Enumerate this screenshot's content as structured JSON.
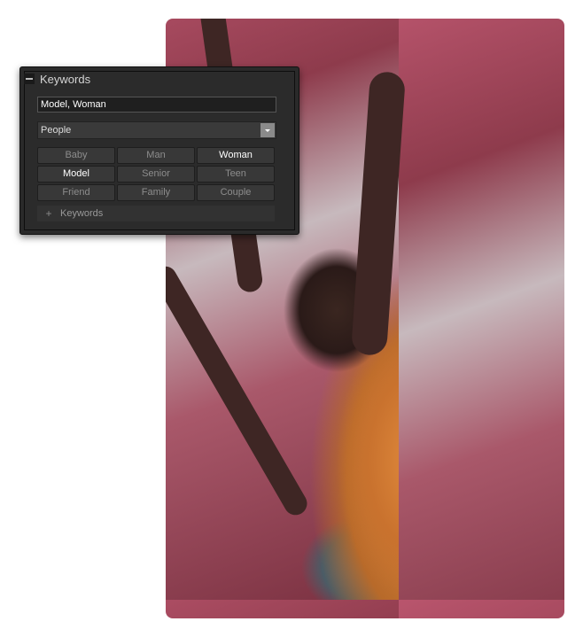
{
  "panel": {
    "title": "Keywords",
    "keywords_value": "Model, Woman",
    "category_selected": "People",
    "tags": [
      {
        "label": "Baby",
        "selected": false
      },
      {
        "label": "Man",
        "selected": false
      },
      {
        "label": "Woman",
        "selected": true
      },
      {
        "label": "Model",
        "selected": true
      },
      {
        "label": "Senior",
        "selected": false
      },
      {
        "label": "Teen",
        "selected": false
      },
      {
        "label": "Friend",
        "selected": false
      },
      {
        "label": "Family",
        "selected": false
      },
      {
        "label": "Couple",
        "selected": false
      }
    ],
    "footer_label": "Keywords"
  }
}
